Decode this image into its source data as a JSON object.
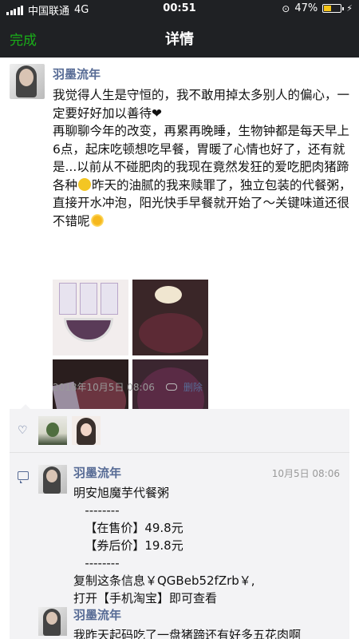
{
  "status_bar": {
    "carrier": "中国联通",
    "network": "4G",
    "time": "00:51",
    "battery_percent": "47%",
    "battery_level": 0.47
  },
  "nav": {
    "left_label": "完成",
    "title": "详情"
  },
  "post": {
    "author": "羽墨流年",
    "paragraphs": [
      [
        "我觉得人生是守恒的，我不敢用掉太多别人的偏心，一定要好好加以善待",
        "❤"
      ],
      [
        "再聊聊今年的改变，再累再晚睡，生物钟都是每天早上6点，起床吃顿想吃早餐，胃暖了心情也好了，还有就是...以前从不碰肥肉的我现在竟然发狂的爱吃肥肉猪蹄各种",
        "昨天的油腻的我来赎罪了，独立包装的代餐粥，直接开水冲泡，阳光快手早餐就开始了～关键味道还很不错呢"
      ]
    ],
    "timestamp": "2018年10月5日 08:06",
    "delete_label": "删除"
  },
  "comments": [
    {
      "author": "羽墨流年",
      "time": "10月5日 08:06",
      "text": "明安旭魔芋代餐粥\n   --------\n   【在售价】49.8元\n   【券后价】19.8元\n   --------\n复制这条信息￥QGBeb52fZrb￥,\n打开【手机淘宝】即可查看"
    },
    {
      "author": "羽墨流年",
      "time": "",
      "text": "我昨天起码吃了一盘猪蹄还有好多五花肉啊"
    }
  ],
  "icons": {
    "like": "heart-outline-icon",
    "comment": "comment-bubble-icon",
    "link": "link-icon"
  },
  "colors": {
    "accent_green": "#1aad19",
    "link_blue": "#576b95",
    "bar_dark": "#1f2124",
    "panel_gray": "#f3f3f5"
  }
}
